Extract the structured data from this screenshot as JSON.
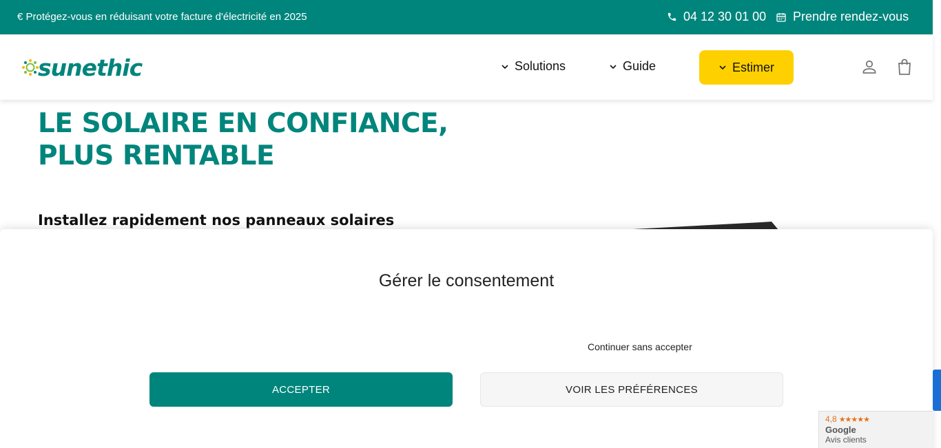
{
  "topbar": {
    "promo": "€ Protégez-vous en réduisant votre facture d'électricité en 2025",
    "phone": "04 12 30 01 00",
    "appointment": "Prendre rendez-vous"
  },
  "header": {
    "logo_text": "sunethic",
    "nav": [
      {
        "label": "Solutions"
      },
      {
        "label": "Guide"
      }
    ],
    "cta": "Estimer"
  },
  "hero": {
    "title_line1": "LE SOLAIRE EN CONFIANCE,",
    "title_line2": "PLUS RENTABLE",
    "subtitle": "Installez rapidement nos panneaux solaires"
  },
  "consent": {
    "title": "Gérer le consentement",
    "continue_label": "Continuer sans accepter",
    "accept_label": "ACCEPTER",
    "preferences_label": "VOIR LES PRÉFÉRENCES"
  },
  "reviews": {
    "rating": "4,8",
    "stars": "★★★★★",
    "brand": "Google",
    "label": "Avis clients"
  },
  "colors": {
    "brand": "#00857c",
    "cta": "#ffd000",
    "side_tab": "#1a6fd6"
  }
}
